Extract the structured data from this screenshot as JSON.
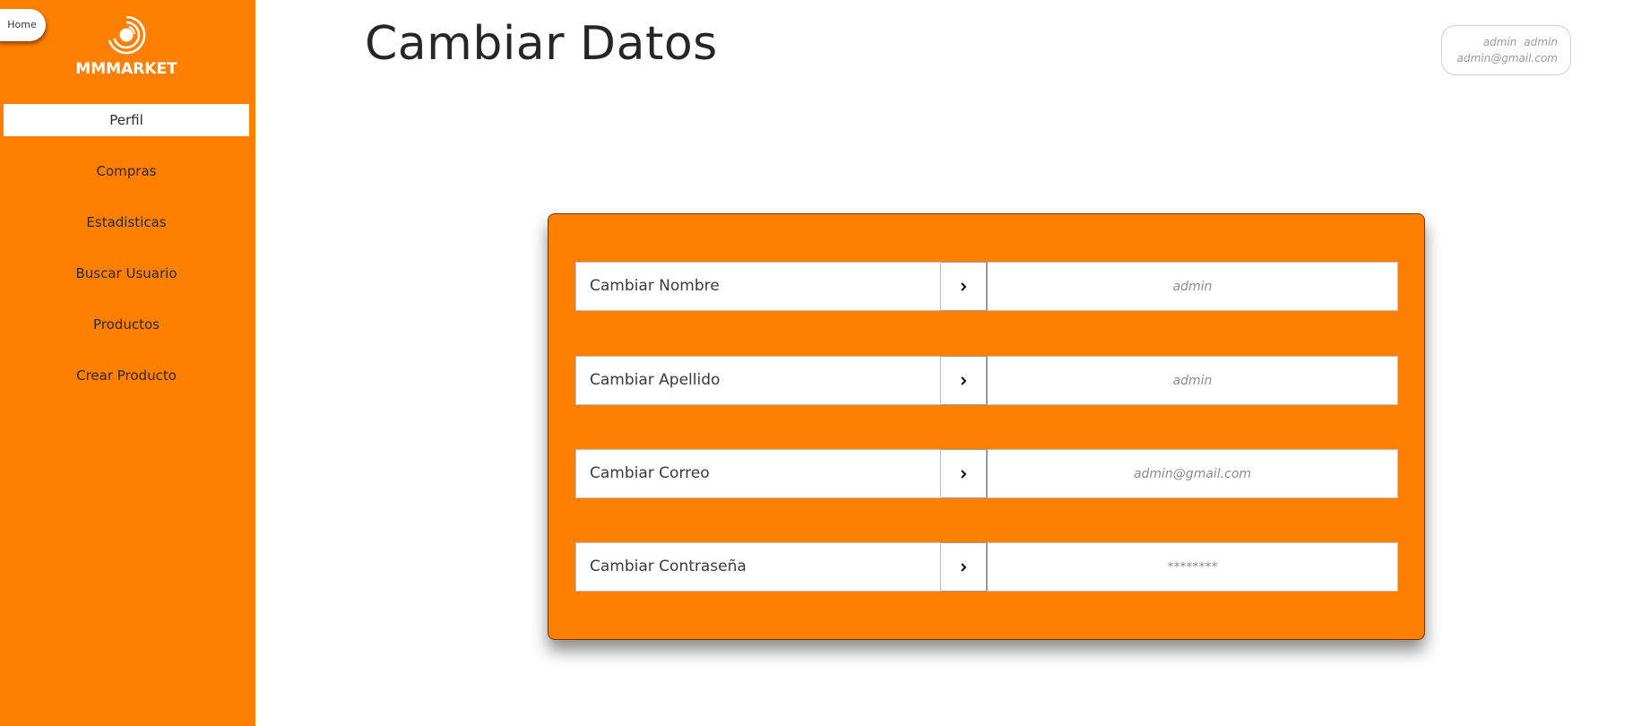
{
  "home_button": "Home",
  "logo": {
    "text": "MMMARKET"
  },
  "sidebar": {
    "items": [
      {
        "label": "Perfil",
        "active": true
      },
      {
        "label": "Compras"
      },
      {
        "label": "Estadisticas"
      },
      {
        "label": "Buscar Usuario"
      },
      {
        "label": "Productos"
      },
      {
        "label": "Crear Producto"
      }
    ]
  },
  "page_title": "Cambiar Datos",
  "user": {
    "first_name": "admin",
    "last_name": "admin",
    "email": "admin@gmail.com"
  },
  "form": {
    "rows": [
      {
        "label": "Cambiar Nombre",
        "placeholder": "admin"
      },
      {
        "label": "Cambiar Apellido",
        "placeholder": "admin"
      },
      {
        "label": "Cambiar Correo",
        "placeholder": "admin@gmail.com"
      },
      {
        "label": "Cambiar Contraseña",
        "placeholder": "********"
      }
    ],
    "submit_icon": "chevron-right-icon"
  },
  "colors": {
    "accent": "#ff7f00",
    "panel_border": "#6b3500"
  }
}
